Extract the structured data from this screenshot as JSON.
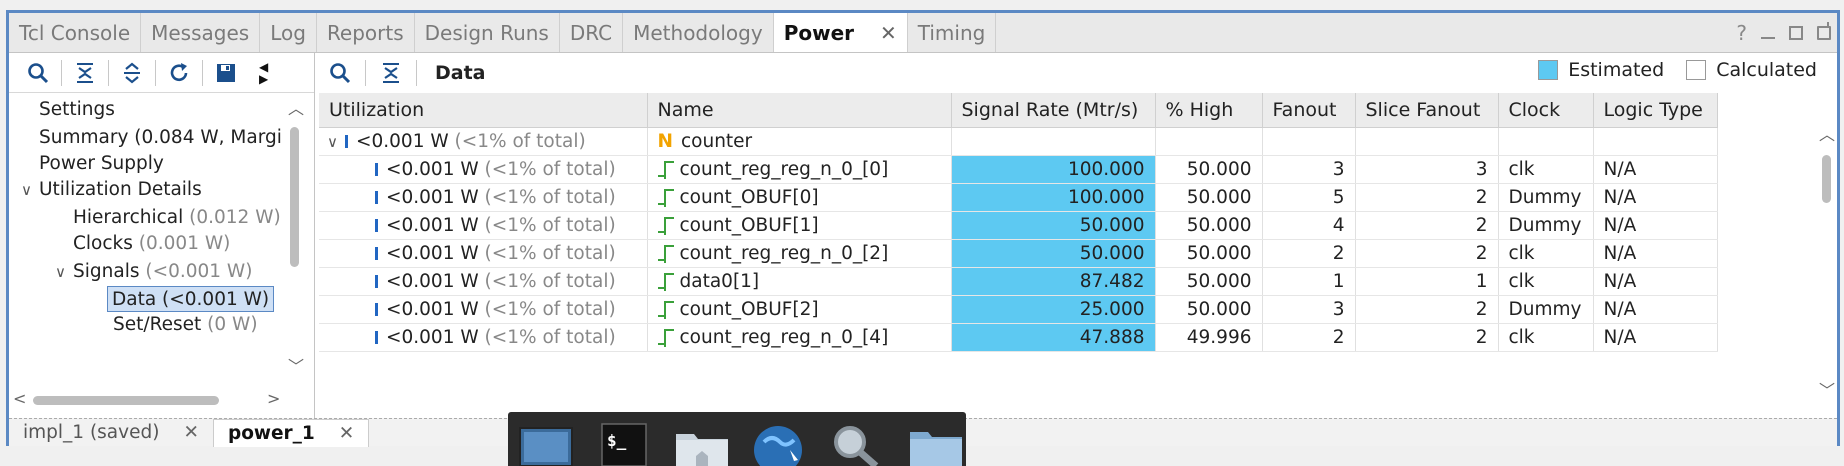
{
  "tabs": [
    {
      "label": "Tcl Console",
      "active": false
    },
    {
      "label": "Messages",
      "active": false
    },
    {
      "label": "Log",
      "active": false
    },
    {
      "label": "Reports",
      "active": false
    },
    {
      "label": "Design Runs",
      "active": false
    },
    {
      "label": "DRC",
      "active": false
    },
    {
      "label": "Methodology",
      "active": false
    },
    {
      "label": "Power",
      "active": true,
      "closable": true
    },
    {
      "label": "Timing",
      "active": false
    }
  ],
  "window_controls": {
    "help": "?"
  },
  "left_tree": [
    {
      "label": "Settings",
      "suffix": "",
      "indent": 0
    },
    {
      "label": "Summary (0.084 W, Margi",
      "suffix": "",
      "indent": 0
    },
    {
      "label": "Power Supply",
      "suffix": "",
      "indent": 0
    },
    {
      "label": "Utilization Details",
      "suffix": "",
      "indent": 0,
      "expanded": true
    },
    {
      "label": "Hierarchical",
      "suffix": " (0.012 W)",
      "indent": 1
    },
    {
      "label": "Clocks",
      "suffix": " (0.001 W)",
      "indent": 1
    },
    {
      "label": "Signals",
      "suffix": " (<0.001 W)",
      "indent": 1,
      "expanded": true
    },
    {
      "label": "Data (<0.001 W)",
      "suffix": "",
      "indent": 2,
      "selected": true
    },
    {
      "label": "Set/Reset",
      "suffix": " (0 W)",
      "indent": 2
    }
  ],
  "panel": {
    "title": "Data"
  },
  "legend": {
    "estimated": "Estimated",
    "calculated": "Calculated",
    "estimated_color": "#5dc9f2"
  },
  "columns": [
    "Utilization",
    "Name",
    "Signal Rate (Mtr/s)",
    "% High",
    "Fanout",
    "Slice Fanout",
    "Clock",
    "Logic Type"
  ],
  "group_row": {
    "util": "<0.001 W",
    "util_dim": " (<1% of total)",
    "name": "counter"
  },
  "rows": [
    {
      "util": "<0.001 W",
      "util_dim": " (<1% of total)",
      "name": "count_reg_reg_n_0_[0]",
      "rate": "100.000",
      "high": "50.000",
      "fanout": "3",
      "slice_fanout": "3",
      "clock": "clk",
      "logic": "N/A"
    },
    {
      "util": "<0.001 W",
      "util_dim": " (<1% of total)",
      "name": "count_OBUF[0]",
      "rate": "100.000",
      "high": "50.000",
      "fanout": "5",
      "slice_fanout": "2",
      "clock": "Dummy",
      "logic": "N/A"
    },
    {
      "util": "<0.001 W",
      "util_dim": " (<1% of total)",
      "name": "count_OBUF[1]",
      "rate": "50.000",
      "high": "50.000",
      "fanout": "4",
      "slice_fanout": "2",
      "clock": "Dummy",
      "logic": "N/A"
    },
    {
      "util": "<0.001 W",
      "util_dim": " (<1% of total)",
      "name": "count_reg_reg_n_0_[2]",
      "rate": "50.000",
      "high": "50.000",
      "fanout": "2",
      "slice_fanout": "2",
      "clock": "clk",
      "logic": "N/A"
    },
    {
      "util": "<0.001 W",
      "util_dim": " (<1% of total)",
      "name": "data0[1]",
      "rate": "87.482",
      "high": "50.000",
      "fanout": "1",
      "slice_fanout": "1",
      "clock": "clk",
      "logic": "N/A"
    },
    {
      "util": "<0.001 W",
      "util_dim": " (<1% of total)",
      "name": "count_OBUF[2]",
      "rate": "25.000",
      "high": "50.000",
      "fanout": "3",
      "slice_fanout": "2",
      "clock": "Dummy",
      "logic": "N/A"
    },
    {
      "util": "<0.001 W",
      "util_dim": " (<1% of total)",
      "name": "count_reg_reg_n_0_[4]",
      "rate": "47.888",
      "high": "49.996",
      "fanout": "2",
      "slice_fanout": "2",
      "clock": "clk",
      "logic": "N/A"
    }
  ],
  "bottom_tabs": [
    {
      "label": "impl_1 (saved)",
      "active": false
    },
    {
      "label": "power_1",
      "active": true
    }
  ],
  "dock_icons": [
    "desktop-icon",
    "terminal-icon",
    "home-folder-icon",
    "browser-globe-icon",
    "search-magnifier-icon",
    "folder-icon"
  ]
}
